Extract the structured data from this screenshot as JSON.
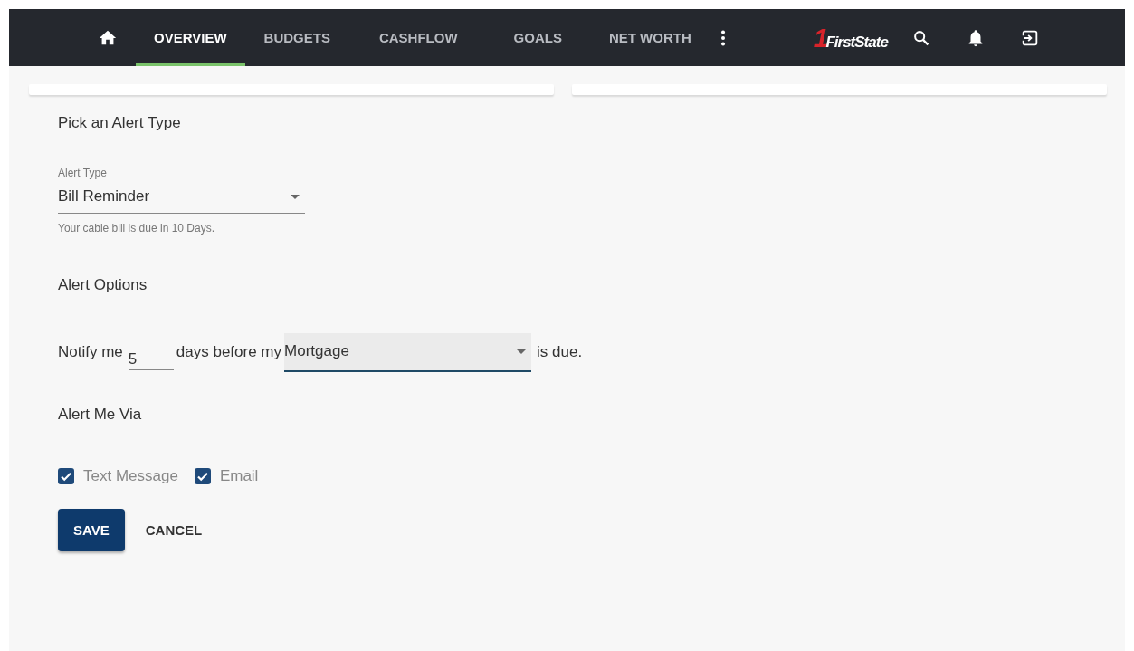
{
  "nav": {
    "tabs": [
      {
        "label": "OVERVIEW",
        "selected": true
      },
      {
        "label": "BUDGETS",
        "selected": false
      },
      {
        "label": "CASHFLOW",
        "selected": false
      },
      {
        "label": "GOALS",
        "selected": false
      },
      {
        "label": "NET WORTH",
        "selected": false
      }
    ],
    "logo": {
      "numeral": "1",
      "name": "FirstState"
    }
  },
  "form": {
    "type_heading": "Pick an Alert Type",
    "alert_type": {
      "label": "Alert Type",
      "value": "Bill Reminder",
      "helper": "Your cable bill is due in 10 Days."
    },
    "options_heading": "Alert Options",
    "sentence": {
      "before": "Notify me",
      "days": "5",
      "middle": "days before my",
      "bill": "Mortgage",
      "after": "is due."
    },
    "via_heading": "Alert Me Via",
    "channels": [
      {
        "label": "Text Message",
        "checked": true
      },
      {
        "label": "Email",
        "checked": true
      }
    ],
    "buttons": [
      {
        "label": "SAVE",
        "kind": "primary"
      },
      {
        "label": "CANCEL",
        "kind": "text"
      }
    ]
  }
}
